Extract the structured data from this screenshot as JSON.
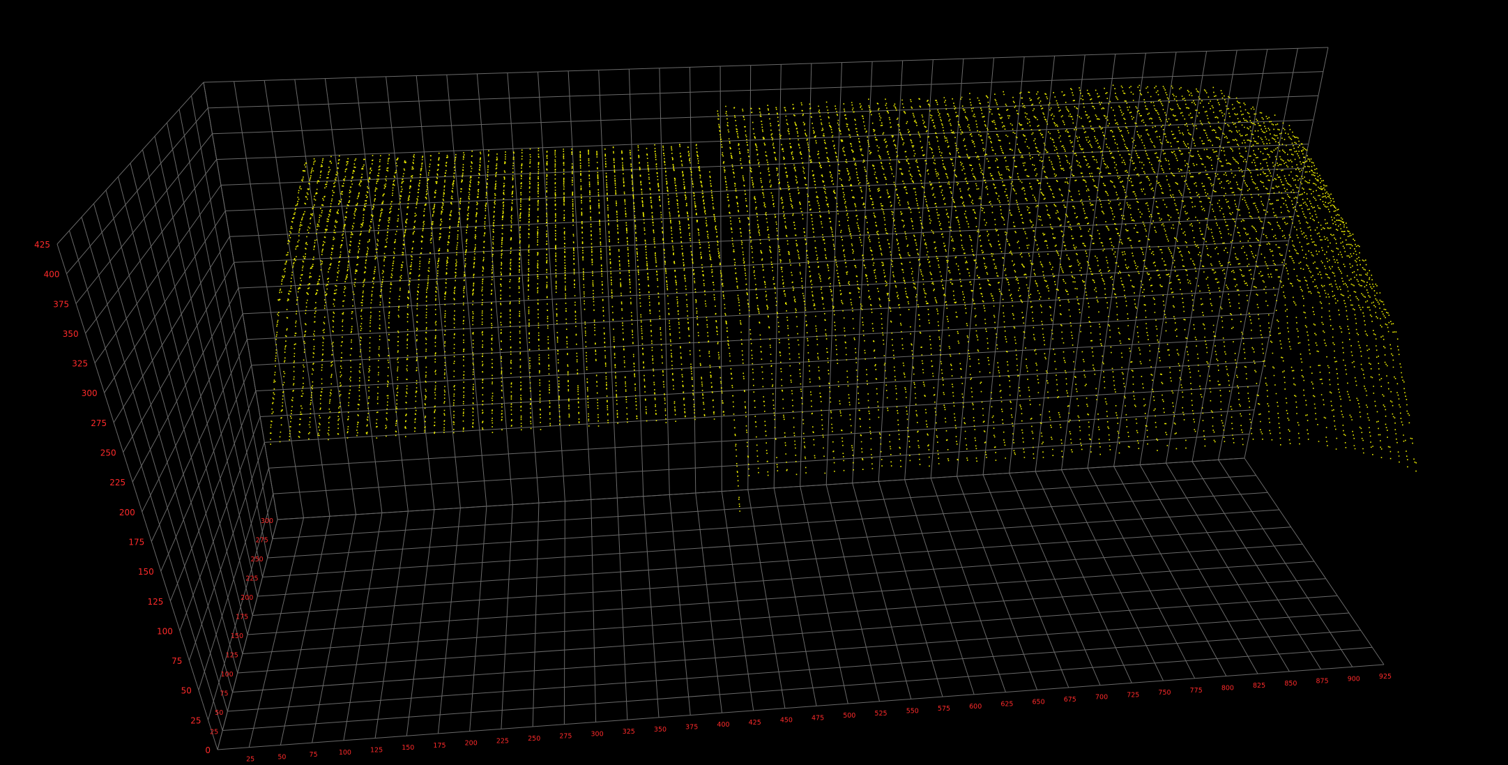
{
  "chart_data": {
    "type": "scatter",
    "title": "",
    "xlabel": "",
    "ylabel": "",
    "zlabel": "",
    "x_ticks": [
      "25",
      "50",
      "75",
      "100",
      "125",
      "150",
      "175",
      "200",
      "225",
      "250",
      "275",
      "300",
      "325",
      "350",
      "375",
      "400",
      "425",
      "450",
      "475",
      "500",
      "525",
      "550",
      "575",
      "600",
      "625",
      "650",
      "675",
      "700",
      "725",
      "750",
      "775",
      "800",
      "825",
      "850",
      "875",
      "900",
      "925"
    ],
    "y_ticks": [
      "25",
      "50",
      "75",
      "100",
      "125",
      "150",
      "175",
      "200",
      "225",
      "250",
      "275",
      "300"
    ],
    "z_ticks": [
      "0",
      "25",
      "50",
      "75",
      "100",
      "125",
      "150",
      "175",
      "200",
      "225",
      "250",
      "275",
      "300",
      "325",
      "350",
      "375",
      "400",
      "425"
    ],
    "x_range": [
      0,
      925
    ],
    "y_range": [
      0,
      300
    ],
    "z_range": [
      0,
      425
    ],
    "grid": true,
    "point_color": "#f2f200",
    "grid_color": "#6a6a6a",
    "tick_color": "#ff2a2a",
    "background": "#000000",
    "series": [
      {
        "profile_y_z": [
          [
            0,
            250
          ],
          [
            40,
            270
          ],
          [
            110,
            318
          ],
          [
            200,
            342
          ],
          [
            300,
            358
          ]
        ],
        "x_start": 75,
        "x_end": 410
      },
      {
        "profile_y_z": [
          [
            0,
            200
          ],
          [
            80,
            300
          ],
          [
            180,
            350
          ],
          [
            280,
            385
          ],
          [
            300,
            395
          ]
        ],
        "x_start": 415,
        "x_end": 925,
        "crest_x_z": [
          [
            420,
            395
          ],
          [
            600,
            398
          ],
          [
            770,
            405
          ],
          [
            840,
            397
          ],
          [
            900,
            360
          ],
          [
            925,
            330
          ]
        ]
      }
    ]
  }
}
